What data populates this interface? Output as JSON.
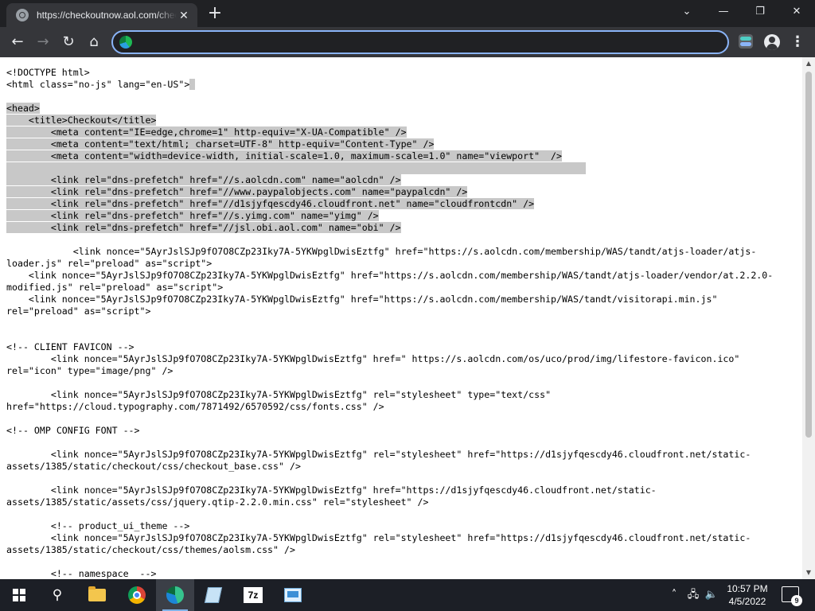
{
  "browser": {
    "tab": {
      "title": "https://checkoutnow.aol.com/checkout"
    },
    "address_bar": {
      "value": ""
    }
  },
  "source_lines": [
    {
      "text": "<!DOCTYPE html>",
      "hl": false
    },
    {
      "text": "<html class=\"no-js\" lang=\"en-US\">",
      "hl": false,
      "trail": " "
    },
    {
      "text": "",
      "hl": false
    },
    {
      "text": "<head>",
      "hl": true
    },
    {
      "text": "    <title>Checkout</title>",
      "hl": true
    },
    {
      "text": "        <meta content=\"IE=edge,chrome=1\" http-equiv=\"X-UA-Compatible\" />",
      "hl": true
    },
    {
      "text": "        <meta content=\"text/html; charset=UTF-8\" http-equiv=\"Content-Type\" />",
      "hl": true
    },
    {
      "text": "        <meta content=\"width=device-width, initial-scale=1.0, maximum-scale=1.0\" name=\"viewport\"  />",
      "hl": true
    },
    {
      "text": "",
      "hl": true
    },
    {
      "text": "        <link rel=\"dns-prefetch\" href=\"//s.aolcdn.com\" name=\"aolcdn\" />",
      "hl": true
    },
    {
      "text": "        <link rel=\"dns-prefetch\" href=\"//www.paypalobjects.com\" name=\"paypalcdn\" />",
      "hl": true
    },
    {
      "text": "        <link rel=\"dns-prefetch\" href=\"//d1sjyfqescdy46.cloudfront.net\" name=\"cloudfrontcdn\" />",
      "hl": true
    },
    {
      "text": "        <link rel=\"dns-prefetch\" href=\"//s.yimg.com\" name=\"yimg\" />",
      "hl": true
    },
    {
      "text": "        <link rel=\"dns-prefetch\" href=\"//jsl.obi.aol.com\" name=\"obi\" />",
      "hl": true
    },
    {
      "text": "",
      "hl": false
    },
    {
      "text": "            <link nonce=\"5AyrJslSJp9fO7O8CZp23Iky7A-5YKWpglDwisEztfg\" href=\"https://s.aolcdn.com/membership/WAS/tandt/atjs-loader/atjs-",
      "hl": false
    },
    {
      "text": "loader.js\" rel=\"preload\" as=\"script\">",
      "hl": false
    },
    {
      "text": "    <link nonce=\"5AyrJslSJp9fO7O8CZp23Iky7A-5YKWpglDwisEztfg\" href=\"https://s.aolcdn.com/membership/WAS/tandt/atjs-loader/vendor/at.2.2.0-",
      "hl": false
    },
    {
      "text": "modified.js\" rel=\"preload\" as=\"script\">",
      "hl": false
    },
    {
      "text": "    <link nonce=\"5AyrJslSJp9fO7O8CZp23Iky7A-5YKWpglDwisEztfg\" href=\"https://s.aolcdn.com/membership/WAS/tandt/visitorapi.min.js\"",
      "hl": false
    },
    {
      "text": "rel=\"preload\" as=\"script\">",
      "hl": false
    },
    {
      "text": "",
      "hl": false
    },
    {
      "text": "",
      "hl": false
    },
    {
      "text": "<!-- CLIENT FAVICON -->",
      "hl": false
    },
    {
      "text": "        <link nonce=\"5AyrJslSJp9fO7O8CZp23Iky7A-5YKWpglDwisEztfg\" href=\" https://s.aolcdn.com/os/uco/prod/img/lifestore-favicon.ico\"",
      "hl": false
    },
    {
      "text": "rel=\"icon\" type=\"image/png\" />",
      "hl": false
    },
    {
      "text": "",
      "hl": false
    },
    {
      "text": "        <link nonce=\"5AyrJslSJp9fO7O8CZp23Iky7A-5YKWpglDwisEztfg\" rel=\"stylesheet\" type=\"text/css\"",
      "hl": false
    },
    {
      "text": "href=\"https://cloud.typography.com/7871492/6570592/css/fonts.css\" />",
      "hl": false
    },
    {
      "text": "",
      "hl": false
    },
    {
      "text": "<!-- OMP CONFIG FONT -->",
      "hl": false
    },
    {
      "text": "",
      "hl": false
    },
    {
      "text": "        <link nonce=\"5AyrJslSJp9fO7O8CZp23Iky7A-5YKWpglDwisEztfg\" rel=\"stylesheet\" href=\"https://d1sjyfqescdy46.cloudfront.net/static-",
      "hl": false
    },
    {
      "text": "assets/1385/static/checkout/css/checkout_base.css\" />",
      "hl": false
    },
    {
      "text": "",
      "hl": false
    },
    {
      "text": "        <link nonce=\"5AyrJslSJp9fO7O8CZp23Iky7A-5YKWpglDwisEztfg\" href=\"https://d1sjyfqescdy46.cloudfront.net/static-",
      "hl": false
    },
    {
      "text": "assets/1385/static/assets/css/jquery.qtip-2.2.0.min.css\" rel=\"stylesheet\" />",
      "hl": false
    },
    {
      "text": "",
      "hl": false
    },
    {
      "text": "        <!-- product_ui_theme -->",
      "hl": false
    },
    {
      "text": "        <link nonce=\"5AyrJslSJp9fO7O8CZp23Iky7A-5YKWpglDwisEztfg\" rel=\"stylesheet\" href=\"https://d1sjyfqescdy46.cloudfront.net/static-",
      "hl": false
    },
    {
      "text": "assets/1385/static/checkout/css/themes/aolsm.css\" />",
      "hl": false
    },
    {
      "text": "",
      "hl": false
    },
    {
      "text": "        <!-- namespace  -->",
      "hl": false
    }
  ],
  "taskbar": {
    "time": "10:57 PM",
    "date": "4/5/2022",
    "notification_count": "9",
    "zip_label": "7z"
  },
  "colors": {
    "selection_highlight": "#c8c8c8",
    "omnibox_focus": "#8ab4f8"
  }
}
